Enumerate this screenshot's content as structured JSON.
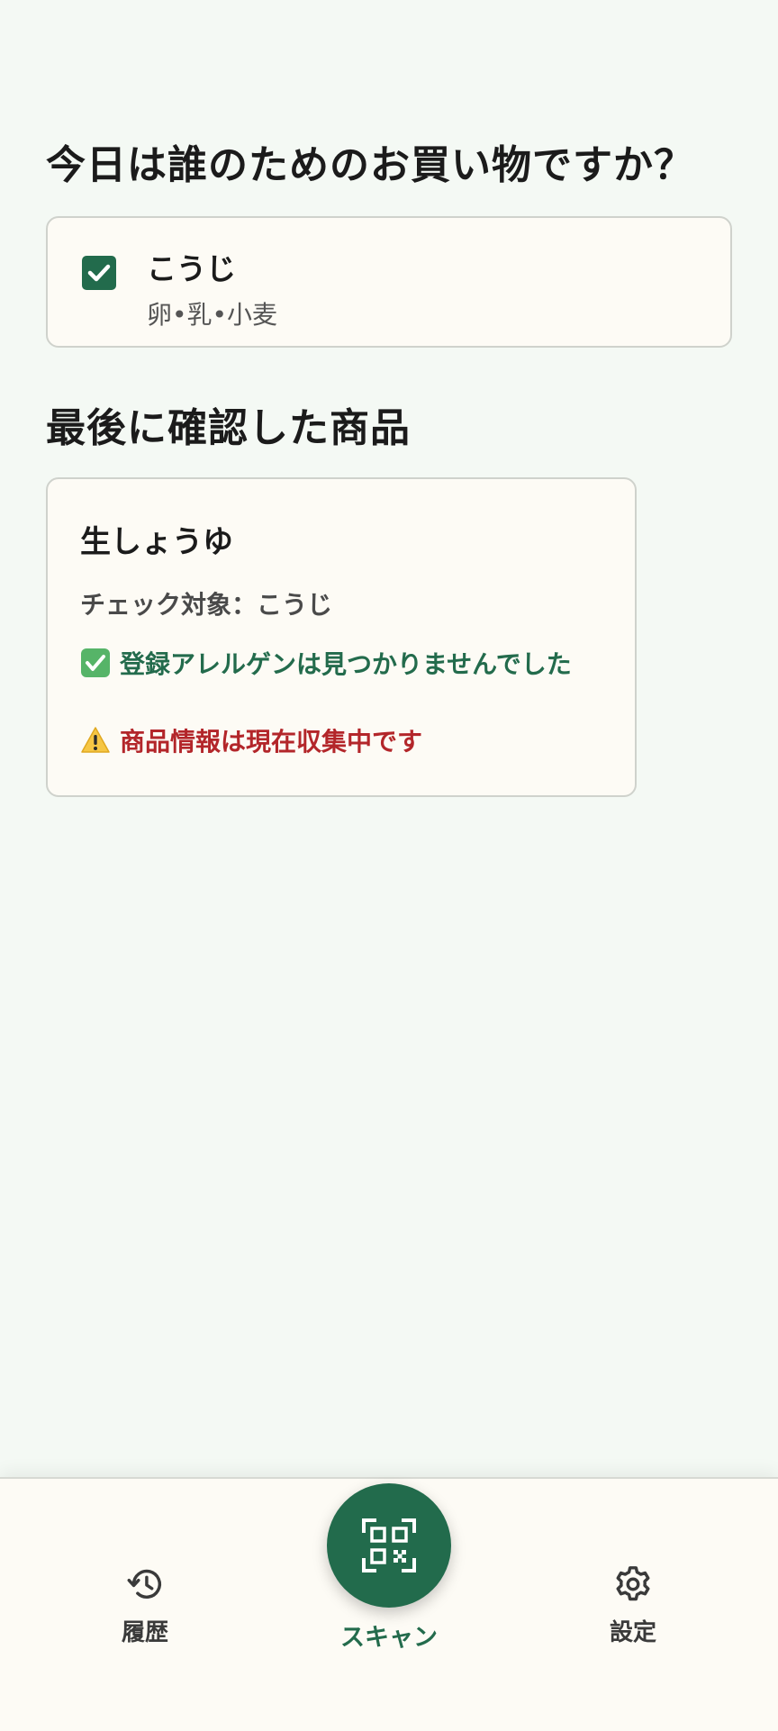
{
  "home": {
    "shopping_title": "今日は誰のためのお買い物ですか？",
    "last_checked_title": "最後に確認した商品"
  },
  "profiles": [
    {
      "name": "こうじ",
      "allergens": "卵•乳•小麦",
      "checked": true
    }
  ],
  "last_product": {
    "name": "生しょうゆ",
    "check_target": "チェック対象：こうじ",
    "status_ok": "登録アレルゲンは見つかりませんでした",
    "status_ok_icon": "check-mark-emoji",
    "status_warning": "商品情報は現在収集中です",
    "status_warning_icon": "warning-emoji"
  },
  "bottom_nav": {
    "history_label": "履歴",
    "history_icon": "history-icon",
    "scan_label": "スキャン",
    "scan_icon": "qr-scan-icon",
    "settings_label": "設定",
    "settings_icon": "gear-icon"
  },
  "colors": {
    "background": "#f4f9f4",
    "card": "#fdfbf5",
    "primary": "#226b4c",
    "ok_text": "#236b4c",
    "warning_text": "#b3262a",
    "checkbox_emoji": "#56b468",
    "warning_emoji": "#f6c644"
  }
}
